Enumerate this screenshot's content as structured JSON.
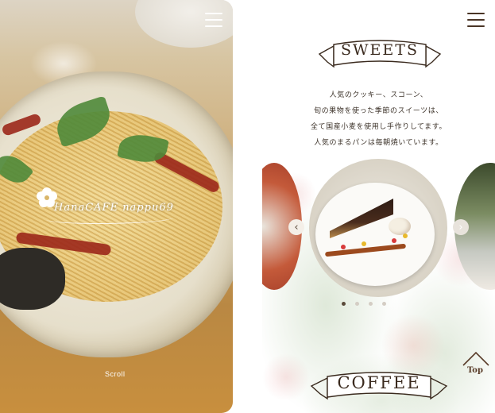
{
  "left_screen": {
    "logo_text": "HanaCAFE nappu69",
    "scroll_label": "Scroll",
    "menu_icon": "hamburger-menu-icon"
  },
  "right_screen": {
    "sweets_heading": "SWEETS",
    "intro_lines": [
      "人気のクッキー、スコーン、",
      "旬の果物を使った季節のスイーツは、",
      "全て国産小麦を使用し手作りしてます。",
      "人気のまるパンは毎朝焼いています。"
    ],
    "coffee_heading": "COFFEE",
    "top_label": "Top",
    "carousel": {
      "prev_icon": "chevron-left-icon",
      "next_icon": "chevron-right-icon",
      "dot_count": 4,
      "active_dot": 0
    },
    "menu_icon": "hamburger-menu-icon"
  },
  "colors": {
    "brown": "#3a2a1e",
    "menu_brown": "#4a3526",
    "white": "#ffffff",
    "dot_active": "#5a4a3a",
    "dot_inactive": "#d4cdc4",
    "arrow_left_bg": "#f4efe8",
    "arrow_right_bg": "#e8e3dc"
  }
}
